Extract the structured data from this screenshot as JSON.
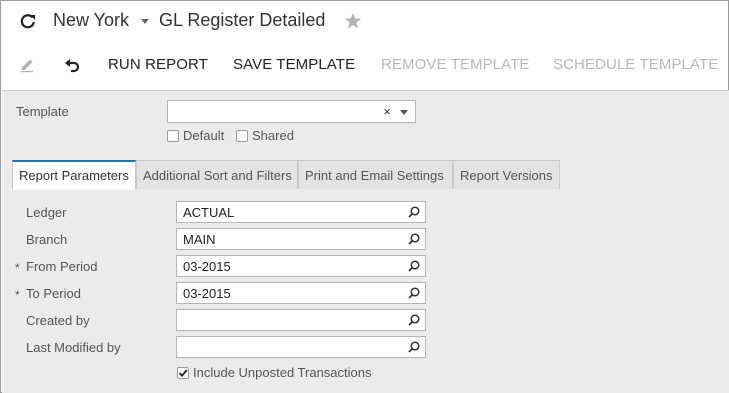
{
  "header": {
    "company": "New York",
    "title": "GL Register Detailed",
    "icons": {
      "refresh": "refresh-icon",
      "company_dropdown": "chevron-down-icon",
      "favorite": "star-icon"
    }
  },
  "toolbar": {
    "edit_icon": "pencil-icon",
    "undo_icon": "undo-icon",
    "run_report": "RUN REPORT",
    "save_template": "SAVE TEMPLATE",
    "remove_template": "REMOVE TEMPLATE",
    "schedule_template": "SCHEDULE TEMPLATE"
  },
  "template": {
    "label": "Template",
    "value": "",
    "clear": "×",
    "default_label": "Default",
    "default_checked": false,
    "shared_label": "Shared",
    "shared_checked": false
  },
  "tabs": [
    {
      "label": "Report Parameters",
      "active": true
    },
    {
      "label": "Additional Sort and Filters",
      "active": false
    },
    {
      "label": "Print and Email Settings",
      "active": false
    },
    {
      "label": "Report Versions",
      "active": false
    }
  ],
  "params": {
    "required_marker": "*",
    "ledger": {
      "label": "Ledger",
      "value": "ACTUAL"
    },
    "branch": {
      "label": "Branch",
      "value": "MAIN"
    },
    "from_period": {
      "label": "From Period",
      "value": "03-2015",
      "required": true
    },
    "to_period": {
      "label": "To Period",
      "value": "03-2015",
      "required": true
    },
    "created_by": {
      "label": "Created by",
      "value": ""
    },
    "last_modified_by": {
      "label": "Last Modified by",
      "value": ""
    },
    "include_unposted": {
      "label": "Include Unposted Transactions",
      "checked": true
    }
  },
  "colors": {
    "accent": "#1b75bc",
    "panel_bg": "#ebebeb",
    "disabled_text": "#b8b8b8"
  }
}
